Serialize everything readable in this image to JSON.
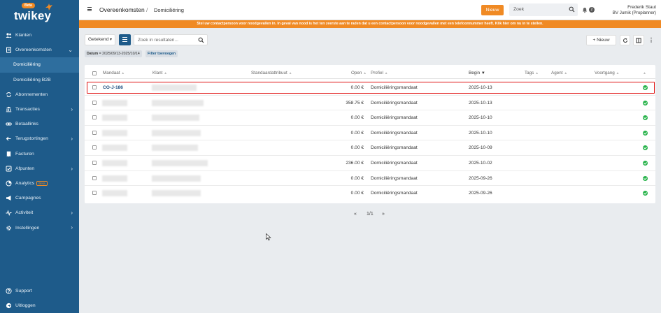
{
  "brand": {
    "logo_text": "twikey",
    "beta_badge": "Beta"
  },
  "sidebar": {
    "items": [
      {
        "label": "Klanten",
        "icon": "users-icon",
        "chevron": false
      },
      {
        "label": "Overeenkomsten",
        "icon": "document-icon",
        "chevron": true,
        "open": true
      },
      {
        "label": "Domiciliëring",
        "sub": true,
        "active": true
      },
      {
        "label": "Domiciliëring B2B",
        "sub": true
      },
      {
        "label": "Abonnementen",
        "icon": "repeat-icon",
        "chevron": false
      },
      {
        "label": "Transacties",
        "icon": "bank-icon",
        "chevron": true
      },
      {
        "label": "Betaallinks",
        "icon": "link-icon",
        "chevron": false
      },
      {
        "label": "Terugstortingen",
        "icon": "refund-icon",
        "chevron": true
      },
      {
        "label": "Facturen",
        "icon": "invoice-icon",
        "chevron": false
      },
      {
        "label": "Afpunten",
        "icon": "reconcile-icon",
        "chevron": true
      },
      {
        "label": "Analytics",
        "icon": "chart-icon",
        "badge": "Beta",
        "chevron": false
      },
      {
        "label": "Campagnes",
        "icon": "megaphone-icon",
        "chevron": false
      },
      {
        "label": "Activiteit",
        "icon": "activity-icon",
        "chevron": true
      },
      {
        "label": "Instellingen",
        "icon": "gear-icon",
        "chevron": true
      }
    ],
    "bottom": [
      {
        "label": "Support",
        "icon": "help-icon"
      },
      {
        "label": "Uitloggen",
        "icon": "logout-icon"
      }
    ]
  },
  "header": {
    "breadcrumb": [
      "Overeenkomsten",
      "Domiciliëring"
    ],
    "separator": "/",
    "new_button": "Nieuw",
    "search_placeholder": "Zoek",
    "notification_count": "2",
    "user_name": "Frederik Staut",
    "user_org": "BV Jumik (Proplanner)"
  },
  "banner": {
    "text": "Stel uw contactpersoon voor noodgevallen in. In geval van nood is het ten zeerste aan te raden dat u een contactpersoon voor noodgevallen met een telefoonnummer heeft. Klik hier om nu in te stellen."
  },
  "toolbar": {
    "status_select": "Getekend",
    "search_placeholder": "Zoek in resultaten...",
    "filter_chip_label": "Datum",
    "filter_chip_value": "= 2025/09/13-2025/10/14",
    "add_filter": "Filter toevoegen",
    "new_button": "+ Nieuw"
  },
  "table": {
    "columns": [
      "Mandaat",
      "Klant",
      "Standaardattribuut",
      "Open",
      "Profiel",
      "Begin",
      "Tags",
      "Agent",
      "Voortgang"
    ],
    "rows": [
      {
        "mandaat": "CO-J-186",
        "open": "0.00 €",
        "profiel": "Domiciliëringsmandaat",
        "begin": "2025-10-13",
        "highlighted": true
      },
      {
        "mandaat": "",
        "open": "358.75 €",
        "profiel": "Domiciliëringsmandaat",
        "begin": "2025-10-13"
      },
      {
        "mandaat": "",
        "open": "0.00 €",
        "profiel": "Domiciliëringsmandaat",
        "begin": "2025-10-10"
      },
      {
        "mandaat": "",
        "open": "0.00 €",
        "profiel": "Domiciliëringsmandaat",
        "begin": "2025-10-10"
      },
      {
        "mandaat": "",
        "open": "0.00 €",
        "profiel": "Domiciliëringsmandaat",
        "begin": "2025-10-09"
      },
      {
        "mandaat": "",
        "open": "236.00 €",
        "profiel": "Domiciliëringsmandaat",
        "begin": "2025-10-02"
      },
      {
        "mandaat": "",
        "open": "0.00 €",
        "profiel": "Domiciliëringsmandaat",
        "begin": "2025-09-26"
      },
      {
        "mandaat": "",
        "open": "0.00 €",
        "profiel": "Domiciliëringsmandaat",
        "begin": "2025-09-26"
      }
    ]
  },
  "pagination": {
    "first": "«",
    "page": "1/1",
    "last": "»"
  },
  "colors": {
    "sidebar": "#1e5b8a",
    "accent": "#f08a24",
    "success": "#27b34a",
    "highlight": "#e01010"
  }
}
